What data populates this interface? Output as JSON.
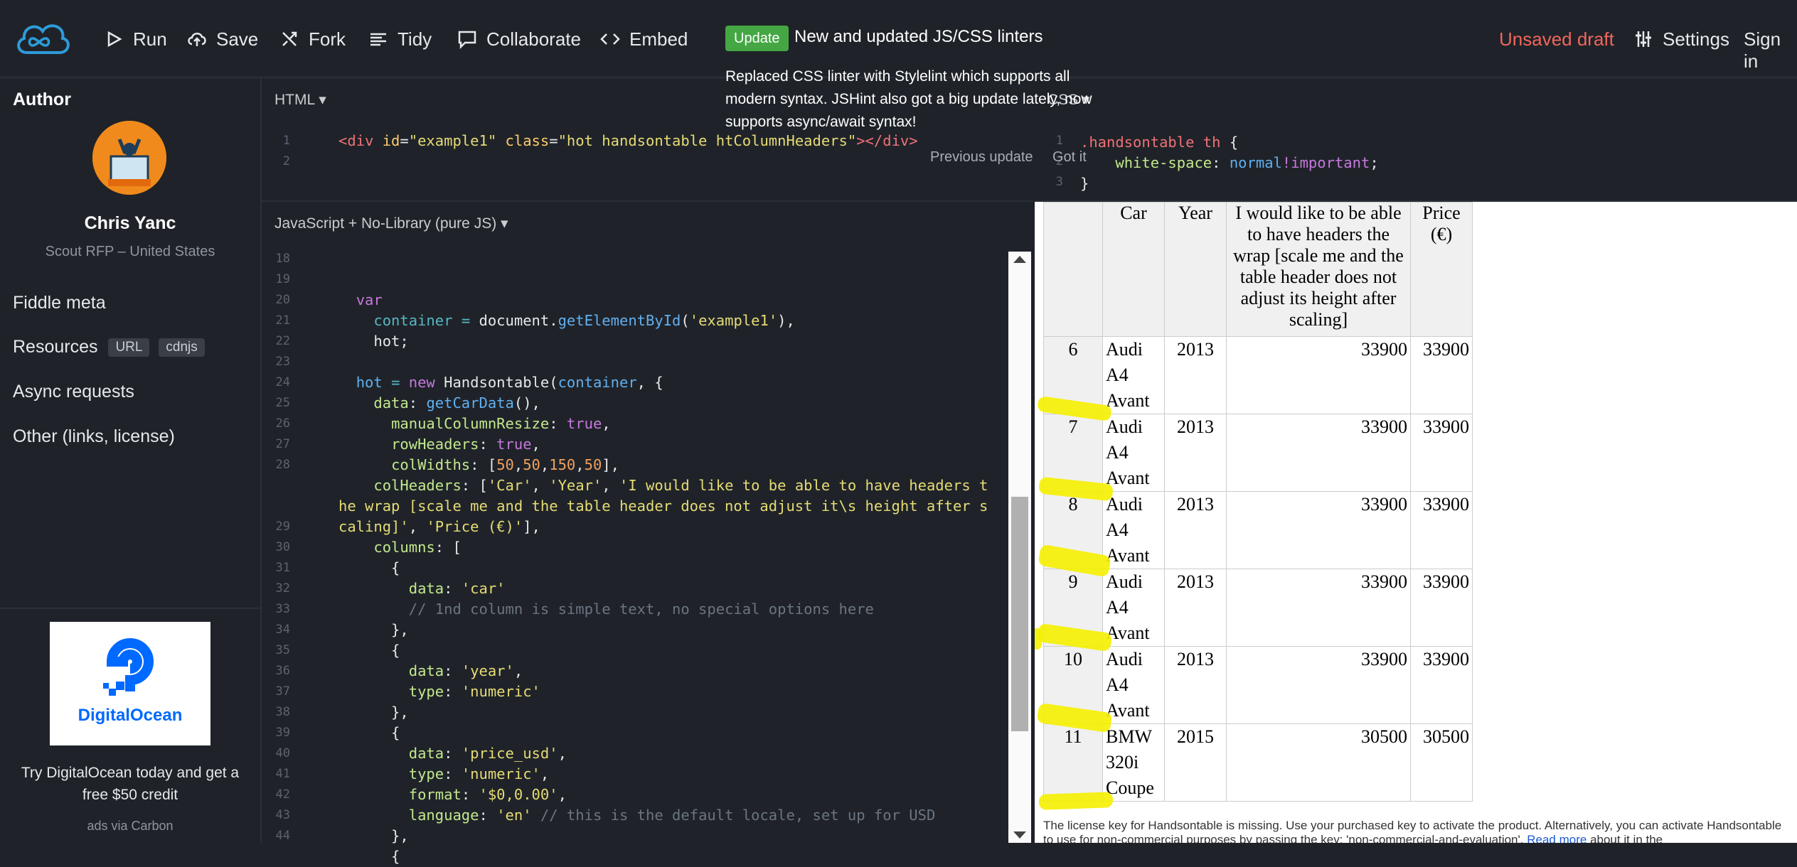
{
  "toolbar": {
    "run_label": "Run",
    "save_label": "Save",
    "fork_label": "Fork",
    "tidy_label": "Tidy",
    "collaborate_label": "Collaborate",
    "embed_label": "Embed",
    "unsaved_label": "Unsaved draft",
    "settings_label": "Settings",
    "signin_label": "Sign in"
  },
  "update": {
    "badge": "Update",
    "headline": "New and updated JS/CSS linters",
    "body": "Replaced CSS linter with Stylelint which supports all modern syntax. JSHint also got a big update lately, now supports async/await syntax!",
    "previous": "Previous update",
    "got_it": "Got it"
  },
  "sidebar": {
    "author_title": "Author",
    "author_name": "Chris Yanc",
    "author_sub": "Scout RFP – United States",
    "links": [
      "Fiddle meta",
      "Resources",
      "Async requests",
      "Other (links, license)"
    ],
    "tags": [
      "URL",
      "cdnjs"
    ],
    "ad_brand": "DigitalOcean",
    "ad_text": "Try DigitalOcean today and get a free $50 credit",
    "ad_via": "ads via Carbon"
  },
  "html_panel": {
    "label": "HTML",
    "lines": [
      "1",
      "2"
    ]
  },
  "css_panel": {
    "label": "CSS",
    "lines": [
      "1",
      "2",
      "3"
    ]
  },
  "js_panel": {
    "label": "JavaScript + No-Library (pure JS)",
    "lines": [
      "18",
      "19",
      "20",
      "21",
      "22",
      "23",
      "24",
      "25",
      "26",
      "27",
      "28",
      "",
      "",
      "29",
      "30",
      "31",
      "32",
      "33",
      "34",
      "35",
      "36",
      "37",
      "38",
      "39",
      "40",
      "41",
      "42",
      "43",
      "44"
    ]
  },
  "result": {
    "headers": [
      "Car",
      "Year",
      "I would like to be able to have headers the wrap [scale me and the table header does not adjust its height after scaling]",
      "Price (€)"
    ],
    "rows": [
      {
        "n": "6",
        "car": "Audi A4 Avant",
        "year": "2013",
        "price1": "33900",
        "price2": "33900"
      },
      {
        "n": "7",
        "car": "Audi A4 Avant",
        "year": "2013",
        "price1": "33900",
        "price2": "33900"
      },
      {
        "n": "8",
        "car": "Audi A4 Avant",
        "year": "2013",
        "price1": "33900",
        "price2": "33900"
      },
      {
        "n": "9",
        "car": "Audi A4 Avant",
        "year": "2013",
        "price1": "33900",
        "price2": "33900"
      },
      {
        "n": "10",
        "car": "Audi A4 Avant",
        "year": "2013",
        "price1": "33900",
        "price2": "33900"
      },
      {
        "n": "11",
        "car": "BMW 320i Coupe",
        "year": "2015",
        "price1": "30500",
        "price2": "30500"
      }
    ],
    "license": "The license key for Handsontable is missing. Use your purchased key to activate the product. Alternatively, you can activate Handsontable to use for non-commercial purposes by passing the key: 'non-commercial-and-evaluation'.",
    "read_more": "Read more",
    "license_tail": "about it in the"
  },
  "colors": {
    "accent_green": "#44a744",
    "unsaved_red": "#f0665c",
    "highlight_yellow": "#f5ef00",
    "background": "#1f2329"
  }
}
